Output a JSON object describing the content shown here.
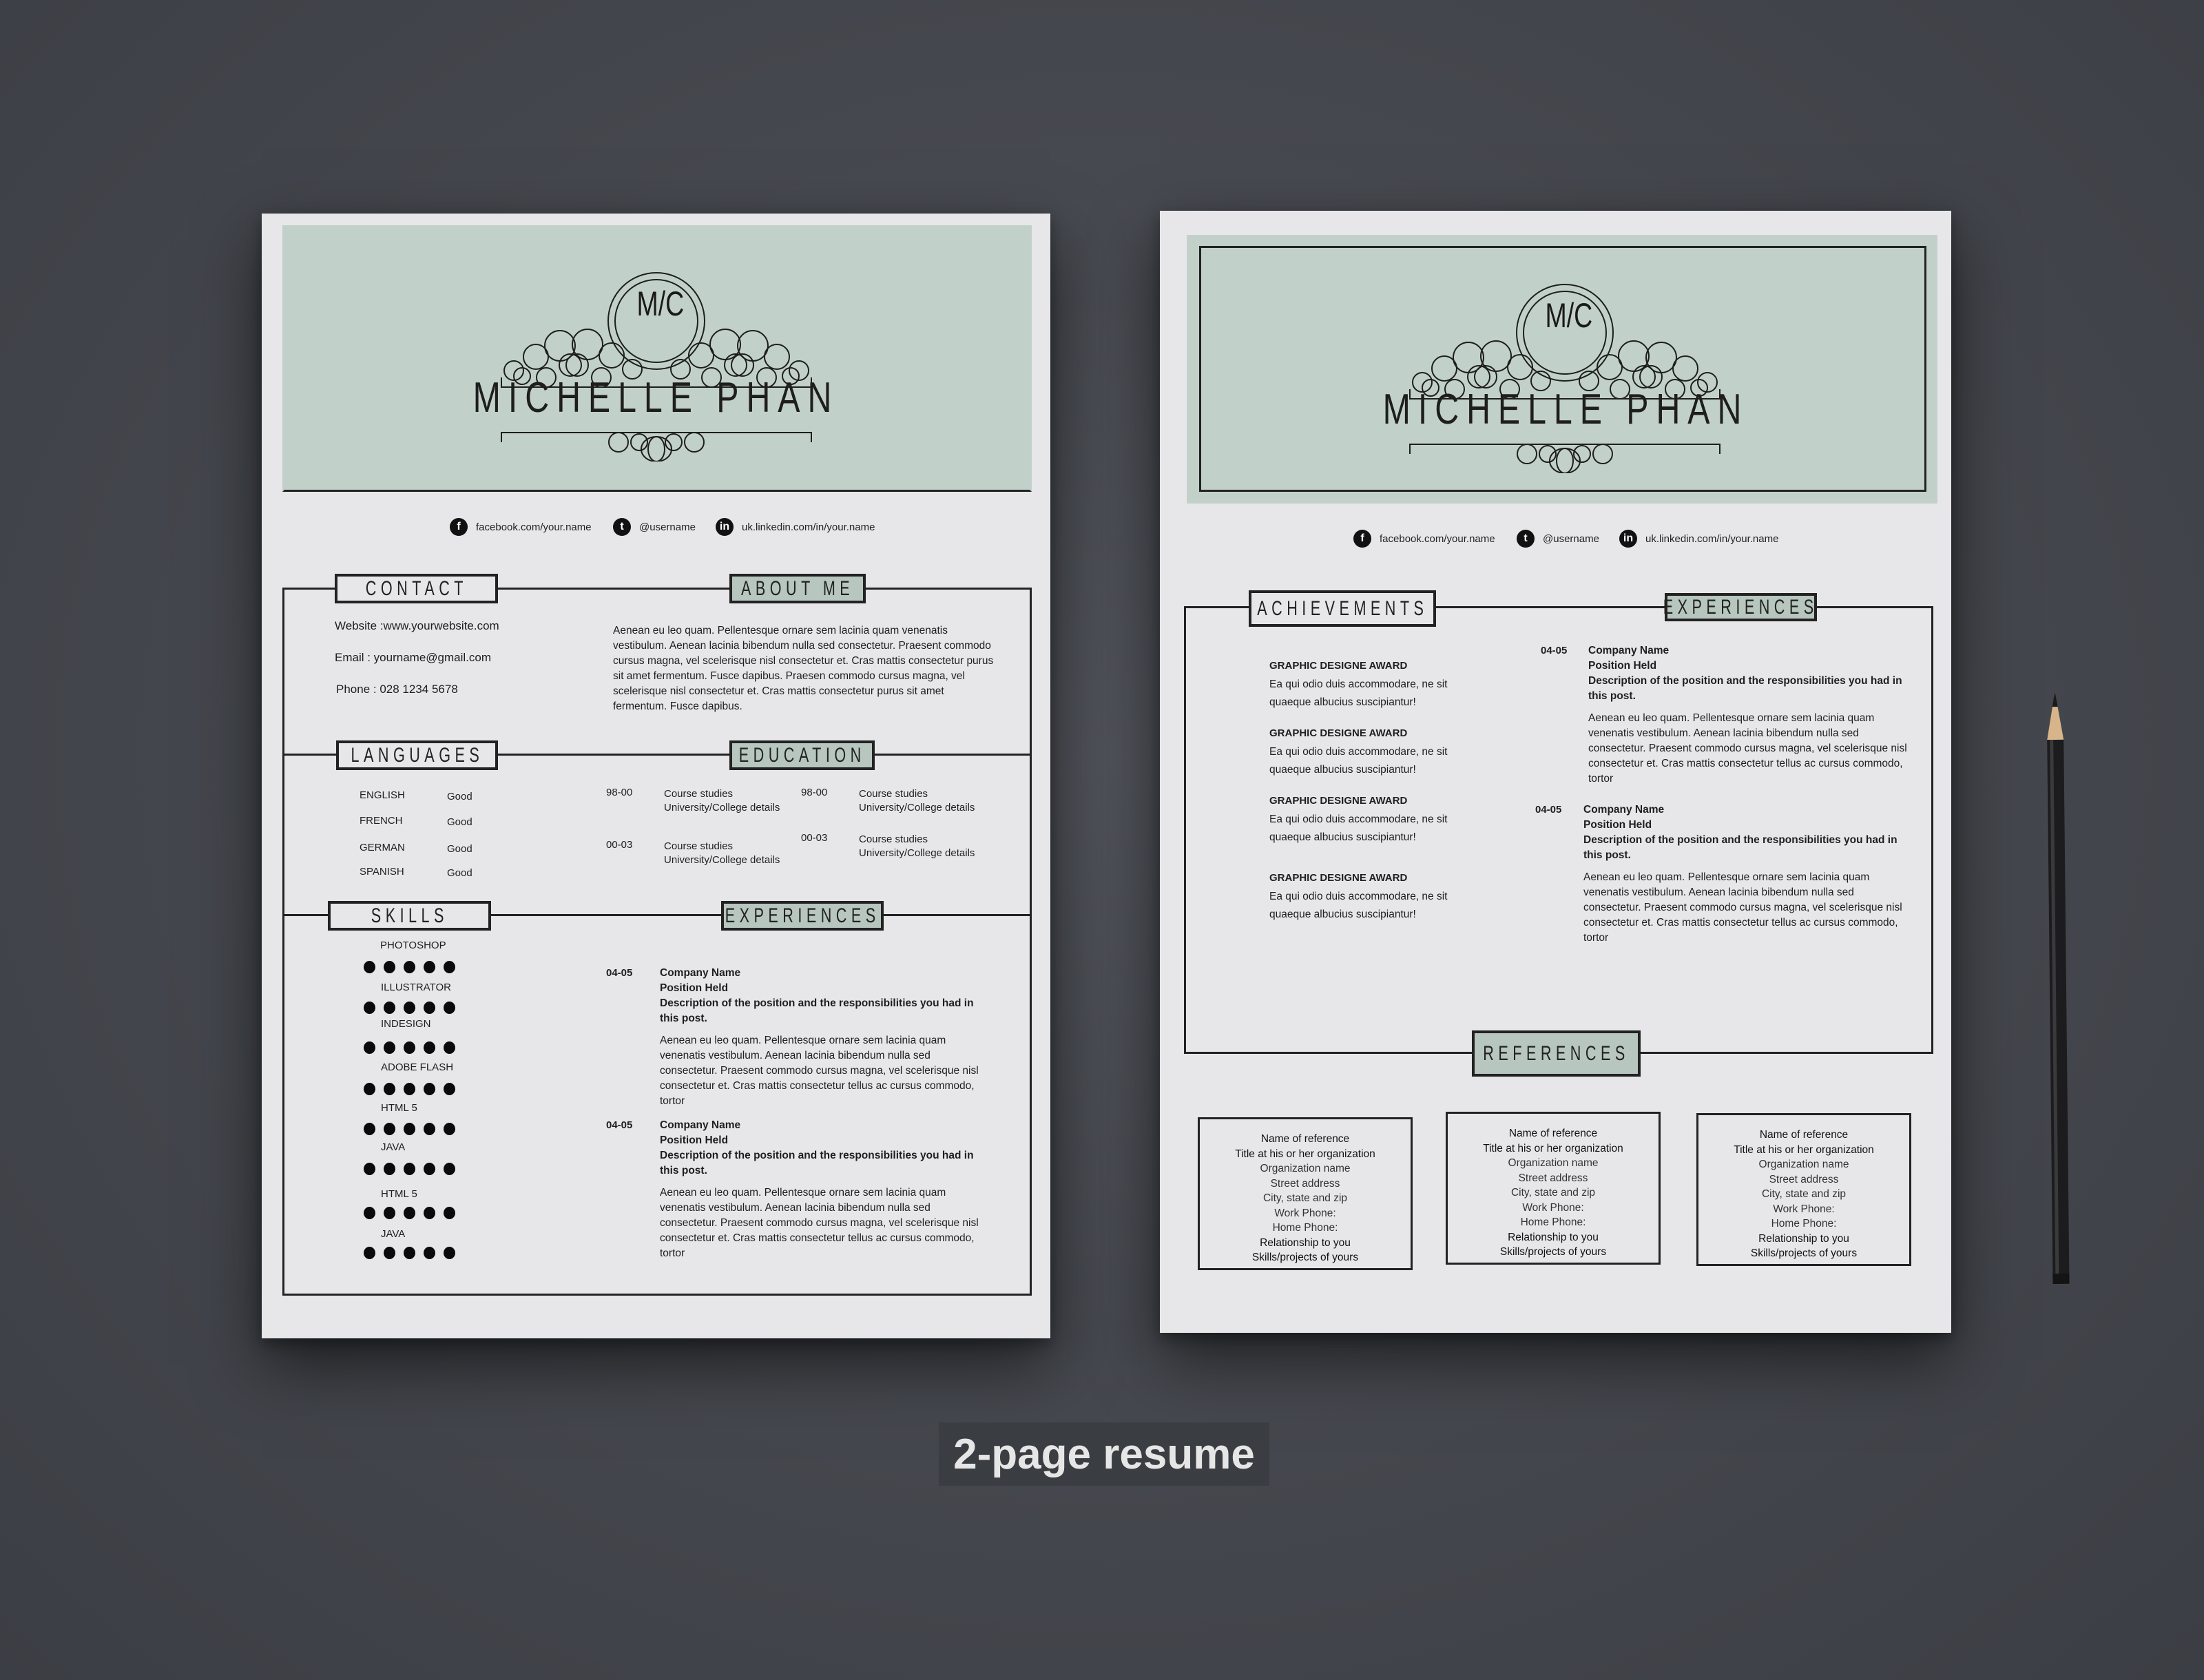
{
  "colors": {
    "header_band": "#c2d0ca",
    "section_fill": "#b7c6be",
    "paper": "#e7e7ea",
    "background": "#45484e",
    "ink": "#1e1e1e"
  },
  "caption": "2-page resume",
  "monogram": "M/C",
  "name": "MICHELLE PHAN",
  "social": [
    {
      "icon": "facebook-icon",
      "glyph": "f",
      "text": "facebook.com/your.name"
    },
    {
      "icon": "twitter-icon",
      "glyph": "t",
      "text": "@username"
    },
    {
      "icon": "linkedin-icon",
      "glyph": "in",
      "text": "uk.linkedin.com/in/your.name"
    }
  ],
  "page1": {
    "sections": {
      "contact": "CONTACT",
      "about": "ABOUT ME",
      "languages": "LANGUAGES",
      "education": "EDUCATION",
      "skills": "SKILLS",
      "experiences": "EXPERIENCES"
    },
    "contact": [
      "Website :www.yourwebsite.com",
      "Email : yourname@gmail.com",
      "Phone : 028 1234 5678"
    ],
    "about": "Aenean eu leo quam. Pellentesque ornare sem lacinia quam venenatis vestibulum. Aenean lacinia bibendum nulla sed consectetur. Praesent commodo cursus magna, vel scelerisque nisl consectetur et. Cras mattis consectetur purus sit amet fermentum. Fusce dapibus. Praesen  commodo cursus magna, vel scelerisque nisl consectetur et. Cras mattis consectetur purus sit amet fermentum. Fusce dapibus.",
    "languages": [
      {
        "name": "ENGLISH",
        "level": "Good"
      },
      {
        "name": "FRENCH",
        "level": "Good"
      },
      {
        "name": "GERMAN",
        "level": "Good"
      },
      {
        "name": "SPANISH",
        "level": "Good"
      }
    ],
    "education": [
      {
        "years": "98-00",
        "line1": "Course studies",
        "line2": "University/College details"
      },
      {
        "years": "00-03",
        "line1": "Course studies",
        "line2": "University/College details"
      },
      {
        "years": "98-00",
        "line1": "Course studies",
        "line2": "University/College details"
      },
      {
        "years": "00-03",
        "line1": "Course studies",
        "line2": "University/College details"
      }
    ],
    "skills": [
      {
        "name": "PHOTOSHOP",
        "rating": 5,
        "max": 5
      },
      {
        "name": "ILLUSTRATOR",
        "rating": 5,
        "max": 5
      },
      {
        "name": "INDESIGN",
        "rating": 5,
        "max": 5
      },
      {
        "name": "ADOBE FLASH",
        "rating": 5,
        "max": 5
      },
      {
        "name": "HTML 5",
        "rating": 5,
        "max": 5
      },
      {
        "name": "JAVA",
        "rating": 5,
        "max": 5
      },
      {
        "name": "HTML 5",
        "rating": 5,
        "max": 5
      },
      {
        "name": "JAVA",
        "rating": 5,
        "max": 5
      }
    ],
    "experiences": [
      {
        "years": "04-05",
        "company": "Company Name",
        "position": "Position Held",
        "description": "Description of the position and the responsibilities you had in this post.",
        "body": "Aenean eu leo quam. Pellentesque ornare sem lacinia quam venenatis vestibulum. Aenean lacinia bibendum nulla sed consectetur. Praesent commodo cursus magna, vel scelerisque nisl consectetur et. Cras mattis consectetur tellus ac cursus commodo, tortor"
      },
      {
        "years": "04-05",
        "company": "Company Name",
        "position": "Position Held",
        "description": "Description of the position and the responsibilities you had in this post.",
        "body": "Aenean eu leo quam. Pellentesque ornare sem lacinia quam venenatis vestibulum. Aenean lacinia bibendum nulla sed consectetur. Praesent commodo cursus magna, vel scelerisque nisl consectetur et. Cras mattis consectetur tellus ac cursus commodo, tortor"
      }
    ]
  },
  "page2": {
    "sections": {
      "achievements": "ACHIEVEMENTS",
      "experiences": "EXPERIENCES",
      "references": "REFERENCES"
    },
    "achievements": [
      {
        "title": "GRAPHIC DESIGNE  AWARD",
        "body": "Ea qui odio duis accommodare, ne sit quaeque albucius suscipiantur!"
      },
      {
        "title": "GRAPHIC DESIGNE  AWARD",
        "body": "Ea qui odio duis accommodare, ne sit quaeque albucius suscipiantur!"
      },
      {
        "title": "GRAPHIC DESIGNE  AWARD",
        "body": "Ea qui odio duis accommodare, ne sit quaeque albucius suscipiantur!"
      },
      {
        "title": "GRAPHIC DESIGNE  AWARD",
        "body": "Ea qui odio duis accommodare, ne sit quaeque albucius suscipiantur!"
      }
    ],
    "experiences": [
      {
        "years": "04-05",
        "company": "Company Name",
        "position": "Position Held",
        "description": "Description of the position and the responsibilities you had in this post.",
        "body": "Aenean eu leo quam. Pellentesque ornare sem lacinia quam venenatis vestibulum. Aenean lacinia bibendum nulla sed consectetur. Praesent commodo cursus magna, vel scelerisque nisl consectetur et. Cras mattis consectetur tellus ac cursus commodo, tortor"
      },
      {
        "years": "04-05",
        "company": "Company Name",
        "position": "Position Held",
        "description": "Description of the position and the responsibilities you had in this post.",
        "body": "Aenean eu leo quam. Pellentesque ornare sem lacinia quam venenatis vestibulum. Aenean lacinia bibendum nulla sed consectetur. Praesent commodo cursus magna, vel scelerisque nisl consectetur et. Cras mattis consectetur tellus ac cursus commodo, tortor"
      }
    ],
    "references": [
      {
        "lines": [
          "Name of reference",
          "Title at his or her organization",
          "Organization name",
          "Street address",
          "City, state and zip",
          "Work Phone:",
          "Home Phone:",
          "Relationship to you",
          "Skills/projects of yours"
        ]
      },
      {
        "lines": [
          "Name of reference",
          "Title at his or her organization",
          "Organization name",
          "Street address",
          "City, state and zip",
          "Work Phone:",
          "Home Phone:",
          "Relationship to you",
          "Skills/projects of yours"
        ]
      },
      {
        "lines": [
          "Name of reference",
          "Title at his or her organization",
          "Organization name",
          "Street address",
          "City, state and zip",
          "Work Phone:",
          "Home Phone:",
          "Relationship to you",
          "Skills/projects of yours"
        ]
      }
    ]
  }
}
